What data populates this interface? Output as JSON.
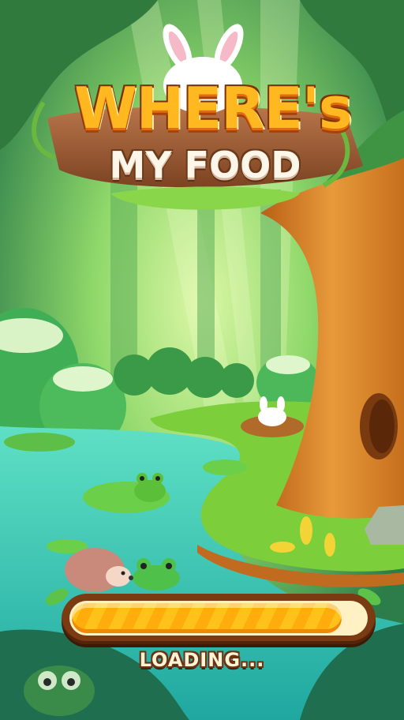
{
  "game": {
    "title_line1": "WHERE's",
    "title_line2": "MY FOOD"
  },
  "loading": {
    "label": "LOADING...",
    "progress": 0.92
  },
  "colors": {
    "title_orange": "#ffb81f",
    "pond": "#29c9b8",
    "grass": "#7ccf3a",
    "tree_trunk": "#e08a2c",
    "loading_bar": "#ffc21a"
  }
}
